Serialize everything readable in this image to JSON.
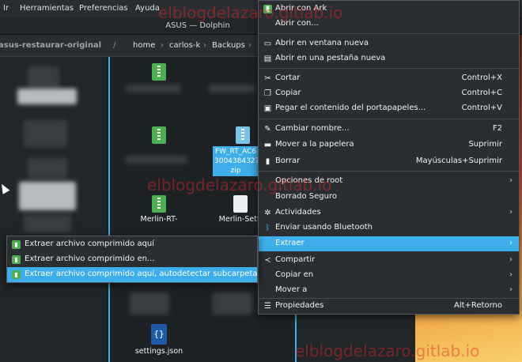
{
  "menubar": {
    "items": [
      "Ir",
      "Herramientas",
      "Preferencias",
      "Ayuda"
    ]
  },
  "window": {
    "title": "ASUS — Dolphin"
  },
  "location": {
    "panel_label": "asus-restaurar-original",
    "root_sep": "/",
    "crumbs": [
      "home",
      "carlos-k",
      "Backups"
    ],
    "sep": "›"
  },
  "files": {
    "items": [
      {
        "name": "",
        "icon": "zip-icon"
      },
      {
        "name": "",
        "icon": "doc-icon"
      },
      {
        "name": "",
        "icon": "zip-icon"
      },
      {
        "name": "FW_RT_AC6 3004384327 zip",
        "icon": "zip-icon",
        "selected": true
      },
      {
        "name": "Merlin-RT-",
        "icon": "zip-icon"
      },
      {
        "name": "Merlin-Setti",
        "icon": "doc-icon"
      },
      {
        "name": "settings.json",
        "icon": "json-icon"
      }
    ]
  },
  "context_menu": {
    "items": [
      {
        "label": "Abrir con Ark",
        "icon": "ark-icon",
        "shortcut": "",
        "submenu": false
      },
      {
        "label": "Abrir con...",
        "icon": "",
        "shortcut": "",
        "submenu": false
      },
      {
        "label": "Abrir en ventana nueva",
        "icon": "window-icon",
        "shortcut": "",
        "submenu": false
      },
      {
        "label": "Abrir en una pestaña nueva",
        "icon": "tab-icon",
        "shortcut": "",
        "submenu": false
      },
      {
        "label": "Cortar",
        "icon": "scissors-icon",
        "shortcut": "Control+X",
        "submenu": false
      },
      {
        "label": "Copiar",
        "icon": "copy-icon",
        "shortcut": "Control+C",
        "submenu": false
      },
      {
        "label": "Pegar el contenido del portapapeles...",
        "icon": "paste-icon",
        "shortcut": "Control+V",
        "submenu": false
      },
      {
        "label": "Cambiar nombre...",
        "icon": "rename-icon",
        "shortcut": "F2",
        "submenu": false
      },
      {
        "label": "Mover a la papelera",
        "icon": "trash-icon",
        "shortcut": "Suprimir",
        "submenu": false
      },
      {
        "label": "Borrar",
        "icon": "delete-icon",
        "shortcut": "Mayúsculas+Suprimir",
        "submenu": false
      },
      {
        "label": "Opciones de root",
        "icon": "",
        "shortcut": "",
        "submenu": true
      },
      {
        "label": "Borrado Seguro",
        "icon": "",
        "shortcut": "",
        "submenu": false
      },
      {
        "label": "Actividades",
        "icon": "activities-icon",
        "shortcut": "",
        "submenu": true
      },
      {
        "label": "Enviar usando Bluetooth",
        "icon": "bluetooth-icon",
        "shortcut": "",
        "submenu": false
      },
      {
        "label": "Extraer",
        "icon": "",
        "shortcut": "",
        "submenu": true,
        "active": true
      },
      {
        "label": "Compartir",
        "icon": "share-icon",
        "shortcut": "",
        "submenu": true
      },
      {
        "label": "Copiar en",
        "icon": "",
        "shortcut": "",
        "submenu": true
      },
      {
        "label": "Mover a",
        "icon": "",
        "shortcut": "",
        "submenu": true
      },
      {
        "label": "Propiedades",
        "icon": "properties-icon",
        "shortcut": "Alt+Retorno",
        "submenu": false
      }
    ],
    "arrow": "›"
  },
  "extract_submenu": {
    "items": [
      {
        "label": "Extraer archivo comprimido aquí",
        "icon": "ark-icon"
      },
      {
        "label": "Extraer archivo comprimido en...",
        "icon": "ark-icon"
      },
      {
        "label": "Extraer archivo comprimido aquí, autodetectar subcarpeta",
        "icon": "ark-icon",
        "active": true
      }
    ]
  },
  "watermark": {
    "text_top": "elblogdelazaro.gitlab.io",
    "text_mid": "elblogdelazaro.gitlab.io",
    "text_bottom": "elblogdelazaro.gitlab.io",
    "color": "#dc2828"
  },
  "colors": {
    "accent": "#3daee9",
    "menu_bg": "#2a2e32",
    "ark_green": "#4caf50"
  }
}
